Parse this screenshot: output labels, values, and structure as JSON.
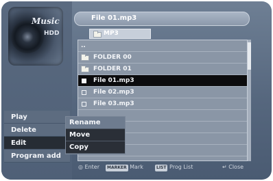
{
  "badge": {
    "title": "Music",
    "subtitle": "HDD"
  },
  "header": {
    "title": "File 01.mp3"
  },
  "folder_tab": {
    "label": "MP3"
  },
  "file_list": {
    "up_label": "..",
    "items": [
      {
        "label": "FOLDER 00",
        "type": "folder"
      },
      {
        "label": "FOLDER 01",
        "type": "folder"
      },
      {
        "label": "File 01.mp3",
        "type": "file",
        "selected": true
      },
      {
        "label": "File 02.mp3",
        "type": "file"
      },
      {
        "label": "File 03.mp3",
        "type": "file"
      }
    ]
  },
  "menu": {
    "items": [
      {
        "label": "Play"
      },
      {
        "label": "Delete"
      },
      {
        "label": "Edit",
        "selected": true
      },
      {
        "label": "Program add"
      }
    ]
  },
  "submenu": {
    "items": [
      {
        "label": "Rename",
        "selected": true
      },
      {
        "label": "Move"
      },
      {
        "label": "Copy"
      }
    ]
  },
  "footer": {
    "enter_label": "Enter",
    "mark_key": "MARKER",
    "mark_label": "Mark",
    "prog_key": "LIST",
    "prog_label": "Prog List",
    "close_label": "Close"
  }
}
